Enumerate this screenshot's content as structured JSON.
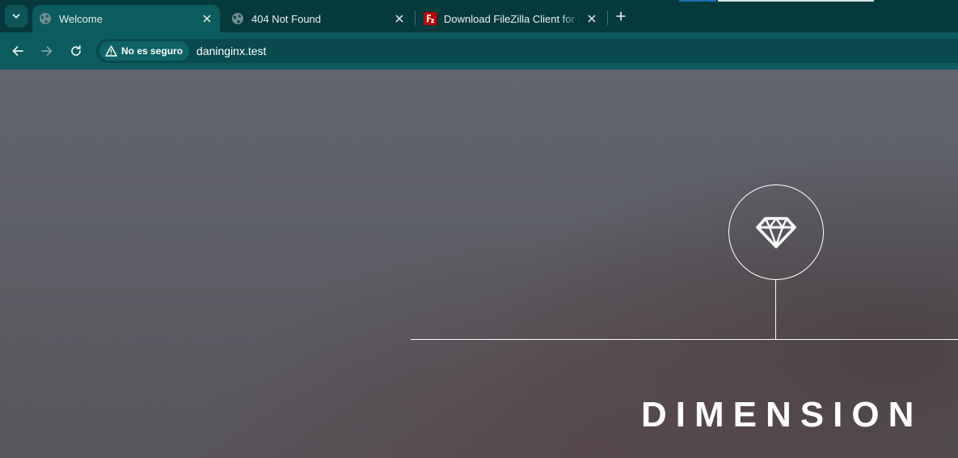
{
  "browser": {
    "tabs": [
      {
        "title": "Welcome",
        "icon": "globe-icon",
        "active": true
      },
      {
        "title": "404 Not Found",
        "icon": "globe-icon",
        "active": false
      },
      {
        "title": "Download FileZilla Client for Wi",
        "icon": "filezilla-icon",
        "active": false
      }
    ],
    "address_bar": {
      "security_label": "No es seguro",
      "url": "daninginx.test"
    },
    "colors": {
      "tab_strip": "#053a3d",
      "toolbar": "#0c5b5e"
    }
  },
  "page": {
    "logo_icon": "diamond-icon",
    "title": "DIMENSION"
  }
}
